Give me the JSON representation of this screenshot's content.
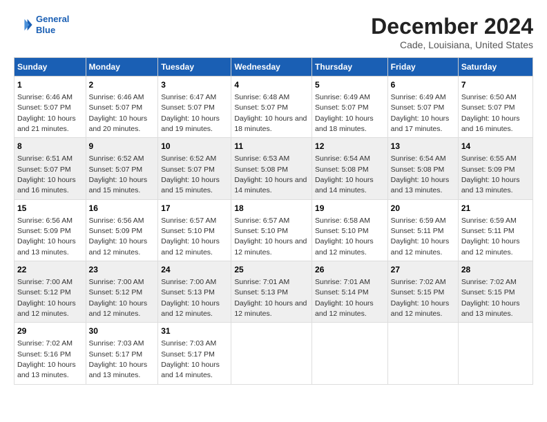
{
  "header": {
    "logo_line1": "General",
    "logo_line2": "Blue",
    "title": "December 2024",
    "subtitle": "Cade, Louisiana, United States"
  },
  "calendar": {
    "columns": [
      "Sunday",
      "Monday",
      "Tuesday",
      "Wednesday",
      "Thursday",
      "Friday",
      "Saturday"
    ],
    "weeks": [
      [
        {
          "day": "",
          "sunrise": "",
          "sunset": "",
          "daylight": ""
        },
        {
          "day": "2",
          "sunrise": "Sunrise: 6:46 AM",
          "sunset": "Sunset: 5:07 PM",
          "daylight": "Daylight: 10 hours and 20 minutes."
        },
        {
          "day": "3",
          "sunrise": "Sunrise: 6:47 AM",
          "sunset": "Sunset: 5:07 PM",
          "daylight": "Daylight: 10 hours and 19 minutes."
        },
        {
          "day": "4",
          "sunrise": "Sunrise: 6:48 AM",
          "sunset": "Sunset: 5:07 PM",
          "daylight": "Daylight: 10 hours and 18 minutes."
        },
        {
          "day": "5",
          "sunrise": "Sunrise: 6:49 AM",
          "sunset": "Sunset: 5:07 PM",
          "daylight": "Daylight: 10 hours and 18 minutes."
        },
        {
          "day": "6",
          "sunrise": "Sunrise: 6:49 AM",
          "sunset": "Sunset: 5:07 PM",
          "daylight": "Daylight: 10 hours and 17 minutes."
        },
        {
          "day": "7",
          "sunrise": "Sunrise: 6:50 AM",
          "sunset": "Sunset: 5:07 PM",
          "daylight": "Daylight: 10 hours and 16 minutes."
        }
      ],
      [
        {
          "day": "8",
          "sunrise": "Sunrise: 6:51 AM",
          "sunset": "Sunset: 5:07 PM",
          "daylight": "Daylight: 10 hours and 16 minutes."
        },
        {
          "day": "9",
          "sunrise": "Sunrise: 6:52 AM",
          "sunset": "Sunset: 5:07 PM",
          "daylight": "Daylight: 10 hours and 15 minutes."
        },
        {
          "day": "10",
          "sunrise": "Sunrise: 6:52 AM",
          "sunset": "Sunset: 5:07 PM",
          "daylight": "Daylight: 10 hours and 15 minutes."
        },
        {
          "day": "11",
          "sunrise": "Sunrise: 6:53 AM",
          "sunset": "Sunset: 5:08 PM",
          "daylight": "Daylight: 10 hours and 14 minutes."
        },
        {
          "day": "12",
          "sunrise": "Sunrise: 6:54 AM",
          "sunset": "Sunset: 5:08 PM",
          "daylight": "Daylight: 10 hours and 14 minutes."
        },
        {
          "day": "13",
          "sunrise": "Sunrise: 6:54 AM",
          "sunset": "Sunset: 5:08 PM",
          "daylight": "Daylight: 10 hours and 13 minutes."
        },
        {
          "day": "14",
          "sunrise": "Sunrise: 6:55 AM",
          "sunset": "Sunset: 5:09 PM",
          "daylight": "Daylight: 10 hours and 13 minutes."
        }
      ],
      [
        {
          "day": "15",
          "sunrise": "Sunrise: 6:56 AM",
          "sunset": "Sunset: 5:09 PM",
          "daylight": "Daylight: 10 hours and 13 minutes."
        },
        {
          "day": "16",
          "sunrise": "Sunrise: 6:56 AM",
          "sunset": "Sunset: 5:09 PM",
          "daylight": "Daylight: 10 hours and 12 minutes."
        },
        {
          "day": "17",
          "sunrise": "Sunrise: 6:57 AM",
          "sunset": "Sunset: 5:10 PM",
          "daylight": "Daylight: 10 hours and 12 minutes."
        },
        {
          "day": "18",
          "sunrise": "Sunrise: 6:57 AM",
          "sunset": "Sunset: 5:10 PM",
          "daylight": "Daylight: 10 hours and 12 minutes."
        },
        {
          "day": "19",
          "sunrise": "Sunrise: 6:58 AM",
          "sunset": "Sunset: 5:10 PM",
          "daylight": "Daylight: 10 hours and 12 minutes."
        },
        {
          "day": "20",
          "sunrise": "Sunrise: 6:59 AM",
          "sunset": "Sunset: 5:11 PM",
          "daylight": "Daylight: 10 hours and 12 minutes."
        },
        {
          "day": "21",
          "sunrise": "Sunrise: 6:59 AM",
          "sunset": "Sunset: 5:11 PM",
          "daylight": "Daylight: 10 hours and 12 minutes."
        }
      ],
      [
        {
          "day": "22",
          "sunrise": "Sunrise: 7:00 AM",
          "sunset": "Sunset: 5:12 PM",
          "daylight": "Daylight: 10 hours and 12 minutes."
        },
        {
          "day": "23",
          "sunrise": "Sunrise: 7:00 AM",
          "sunset": "Sunset: 5:12 PM",
          "daylight": "Daylight: 10 hours and 12 minutes."
        },
        {
          "day": "24",
          "sunrise": "Sunrise: 7:00 AM",
          "sunset": "Sunset: 5:13 PM",
          "daylight": "Daylight: 10 hours and 12 minutes."
        },
        {
          "day": "25",
          "sunrise": "Sunrise: 7:01 AM",
          "sunset": "Sunset: 5:13 PM",
          "daylight": "Daylight: 10 hours and 12 minutes."
        },
        {
          "day": "26",
          "sunrise": "Sunrise: 7:01 AM",
          "sunset": "Sunset: 5:14 PM",
          "daylight": "Daylight: 10 hours and 12 minutes."
        },
        {
          "day": "27",
          "sunrise": "Sunrise: 7:02 AM",
          "sunset": "Sunset: 5:15 PM",
          "daylight": "Daylight: 10 hours and 12 minutes."
        },
        {
          "day": "28",
          "sunrise": "Sunrise: 7:02 AM",
          "sunset": "Sunset: 5:15 PM",
          "daylight": "Daylight: 10 hours and 13 minutes."
        }
      ],
      [
        {
          "day": "29",
          "sunrise": "Sunrise: 7:02 AM",
          "sunset": "Sunset: 5:16 PM",
          "daylight": "Daylight: 10 hours and 13 minutes."
        },
        {
          "day": "30",
          "sunrise": "Sunrise: 7:03 AM",
          "sunset": "Sunset: 5:17 PM",
          "daylight": "Daylight: 10 hours and 13 minutes."
        },
        {
          "day": "31",
          "sunrise": "Sunrise: 7:03 AM",
          "sunset": "Sunset: 5:17 PM",
          "daylight": "Daylight: 10 hours and 14 minutes."
        },
        {
          "day": "",
          "sunrise": "",
          "sunset": "",
          "daylight": ""
        },
        {
          "day": "",
          "sunrise": "",
          "sunset": "",
          "daylight": ""
        },
        {
          "day": "",
          "sunrise": "",
          "sunset": "",
          "daylight": ""
        },
        {
          "day": "",
          "sunrise": "",
          "sunset": "",
          "daylight": ""
        }
      ]
    ],
    "first_week": [
      {
        "day": "1",
        "sunrise": "Sunrise: 6:46 AM",
        "sunset": "Sunset: 5:07 PM",
        "daylight": "Daylight: 10 hours and 21 minutes."
      }
    ]
  }
}
